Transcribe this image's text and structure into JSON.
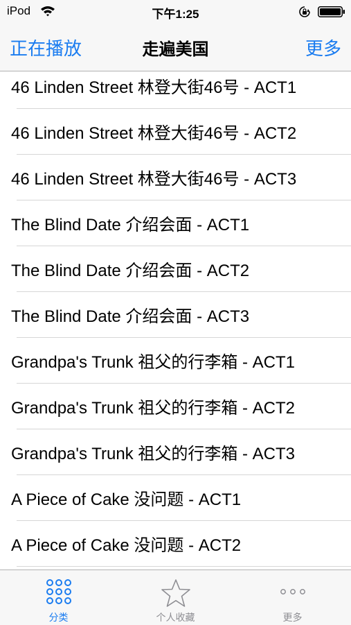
{
  "status_bar": {
    "carrier": "iPod",
    "time": "下午1:25",
    "icons": [
      "wifi-icon",
      "rotation-lock-icon",
      "battery-icon"
    ]
  },
  "nav": {
    "left_label": "正在播放",
    "title": "走遍美国",
    "right_label": "更多"
  },
  "list": {
    "items": [
      "46 Linden Street 林登大街46号 - ACT1",
      "46 Linden Street 林登大街46号 - ACT2",
      "46 Linden Street 林登大街46号 - ACT3",
      "The Blind Date 介绍会面 - ACT1",
      "The Blind Date 介绍会面 - ACT2",
      "The Blind Date 介绍会面 - ACT3",
      "Grandpa's Trunk 祖父的行李箱 - ACT1",
      "Grandpa's Trunk 祖父的行李箱 - ACT2",
      "Grandpa's Trunk 祖父的行李箱 - ACT3",
      "A Piece of Cake 没问题 - ACT1",
      "A Piece of Cake 没问题 - ACT2"
    ]
  },
  "tab_bar": {
    "tabs": [
      {
        "label": "分类",
        "icon": "grid-icon",
        "active": true
      },
      {
        "label": "个人收藏",
        "icon": "star-icon",
        "active": false
      },
      {
        "label": "更多",
        "icon": "more-icon",
        "active": false
      }
    ]
  },
  "colors": {
    "accent": "#1a7cf0",
    "inactive": "#8e8e93",
    "bar_background": "#f7f7f7",
    "separator": "#d6d6d6"
  }
}
